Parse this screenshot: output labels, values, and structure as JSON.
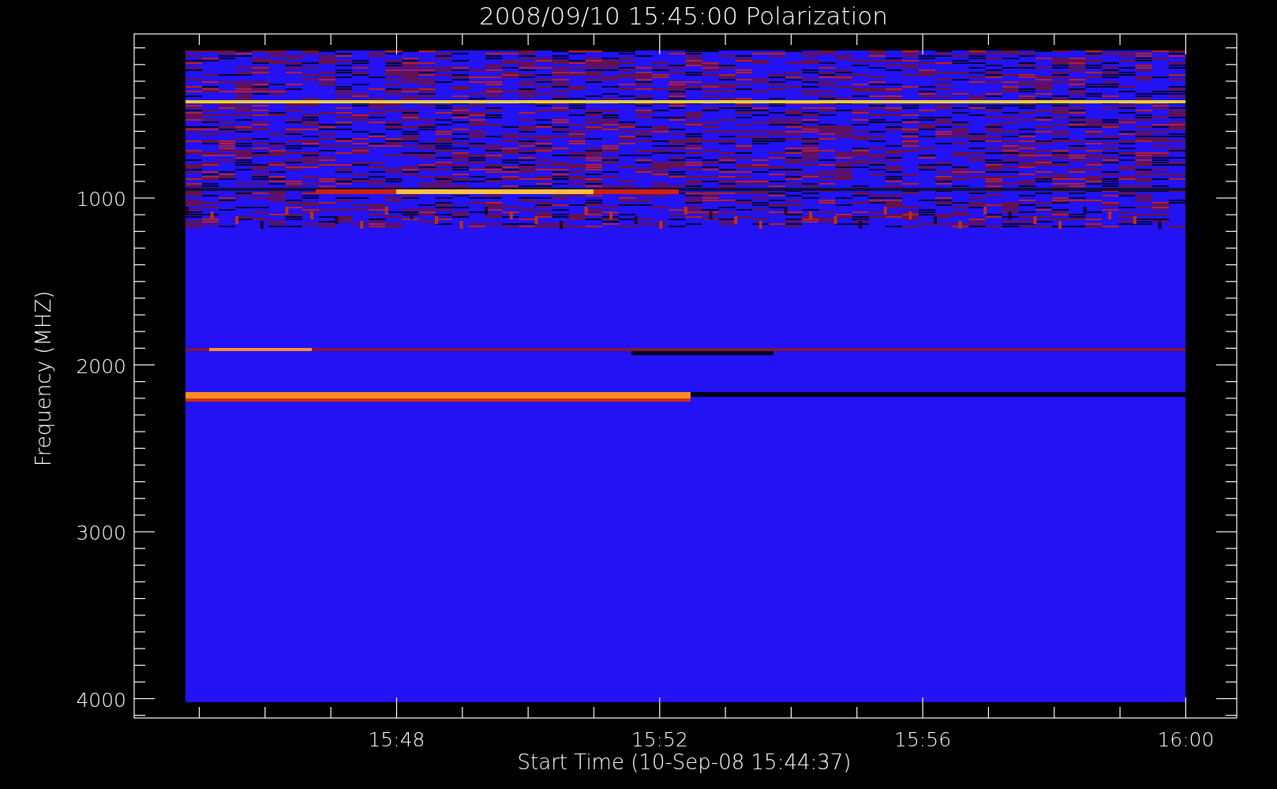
{
  "title": "2008/09/10 15:45:00 Polarization",
  "y_axis": {
    "label": "Frequency (MHZ)",
    "ticks": [
      "1000",
      "2000",
      "3000",
      "4000"
    ]
  },
  "x_axis": {
    "label": "Start Time (10-Sep-08 15:44:37)",
    "ticks": [
      "15:48",
      "15:52",
      "15:56",
      "16:00"
    ]
  }
}
